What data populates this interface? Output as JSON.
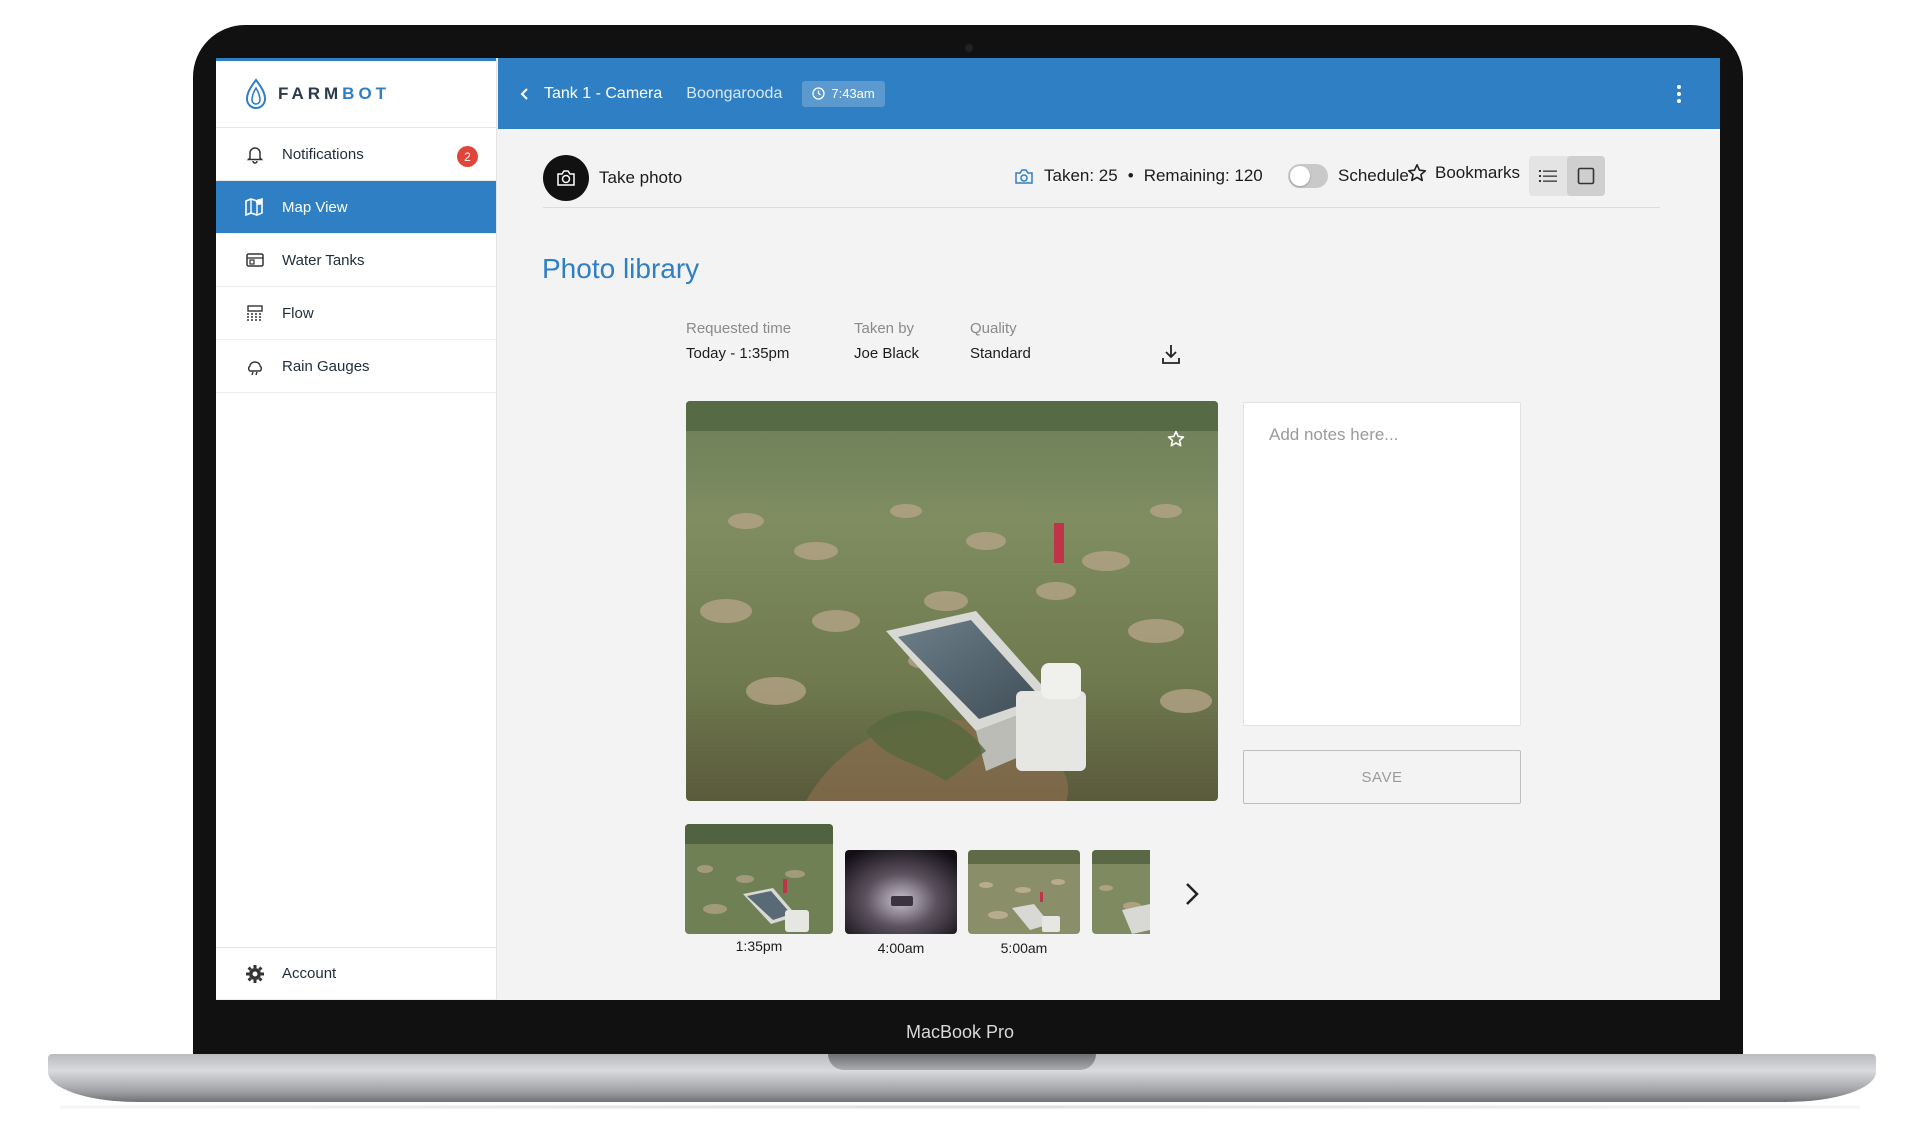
{
  "device": {
    "label": "MacBook Pro"
  },
  "brand": {
    "name_part1": "FARM",
    "name_part2": "BOT"
  },
  "sidebar": {
    "items": [
      {
        "label": "Notifications",
        "icon": "bell-icon",
        "badge": "2"
      },
      {
        "label": "Map View",
        "icon": "map-icon",
        "active": true
      },
      {
        "label": "Water Tanks",
        "icon": "tank-icon"
      },
      {
        "label": "Flow",
        "icon": "flow-icon"
      },
      {
        "label": "Rain Gauges",
        "icon": "rain-gauge-icon"
      }
    ],
    "account": {
      "label": "Account",
      "icon": "gear-icon"
    }
  },
  "topbar": {
    "title": "Tank 1 - Camera",
    "location": "Boongarooda",
    "time": "7:43am"
  },
  "toolbar": {
    "take_photo": "Take photo",
    "taken": "Taken: 25",
    "separator": "•",
    "remaining": "Remaining: 120",
    "schedule": "Schedule",
    "schedule_on": false,
    "bookmarks": "Bookmarks"
  },
  "library": {
    "title": "Photo library",
    "requested_label": "Requested time",
    "requested_value": "Today - 1:35pm",
    "taken_by_label": "Taken by",
    "taken_by_value": "Joe Black",
    "quality_label": "Quality",
    "quality_value": "Standard",
    "notes_placeholder": "Add notes here...",
    "save_label": "SAVE"
  },
  "thumbnails": [
    {
      "time": "1:35pm",
      "selected": true
    },
    {
      "time": "4:00am"
    },
    {
      "time": "5:00am"
    },
    {
      "time": ""
    }
  ],
  "colors": {
    "accent": "#2f7fc4",
    "badge": "#e0453a"
  }
}
